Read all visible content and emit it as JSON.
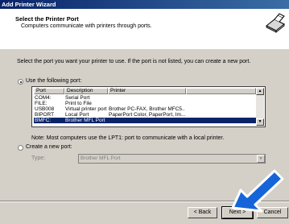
{
  "window": {
    "title": "Add Printer Wizard"
  },
  "header": {
    "title": "Select the Printer Port",
    "subtitle": "Computers communicate with printers through ports."
  },
  "intro": "Select the port you want your printer to use.  If the port is not listed, you can create a new port.",
  "use_port": {
    "label": "Use the following port:",
    "selected": true
  },
  "port_table": {
    "columns": [
      "Port",
      "Description",
      "Printer"
    ],
    "rows": [
      {
        "port": "COM4:",
        "description": "Serial Port",
        "printer": ""
      },
      {
        "port": "FILE:",
        "description": "Print to File",
        "printer": ""
      },
      {
        "port": "USB008",
        "description": "Virtual printer port for ...",
        "printer": "Brother PC-FAX, Brother MFC5..."
      },
      {
        "port": "BIPORT",
        "description": "Local Port",
        "printer": "PaperPort Color, PaperPort, Im..."
      },
      {
        "port": "BMFC:",
        "description": "Brother MFL Port",
        "printer": "",
        "selected": true
      }
    ]
  },
  "note": "Note: Most computers use the LPT1: port to communicate with a local printer.",
  "create_port": {
    "label": "Create a new port:",
    "selected": false,
    "type_label": "Type:",
    "type_value": "Brother MFL Port"
  },
  "buttons": {
    "back": "< Back",
    "next": "Next >",
    "cancel": "Cancel"
  },
  "colors": {
    "title_bar": "#0a246a",
    "selection": "#0a246a",
    "arrow": "#1565d8"
  },
  "icons": {
    "header": "printer-port-icon",
    "scroll_up": "triangle-up",
    "scroll_down": "triangle-down",
    "combo": "triangle-down"
  }
}
